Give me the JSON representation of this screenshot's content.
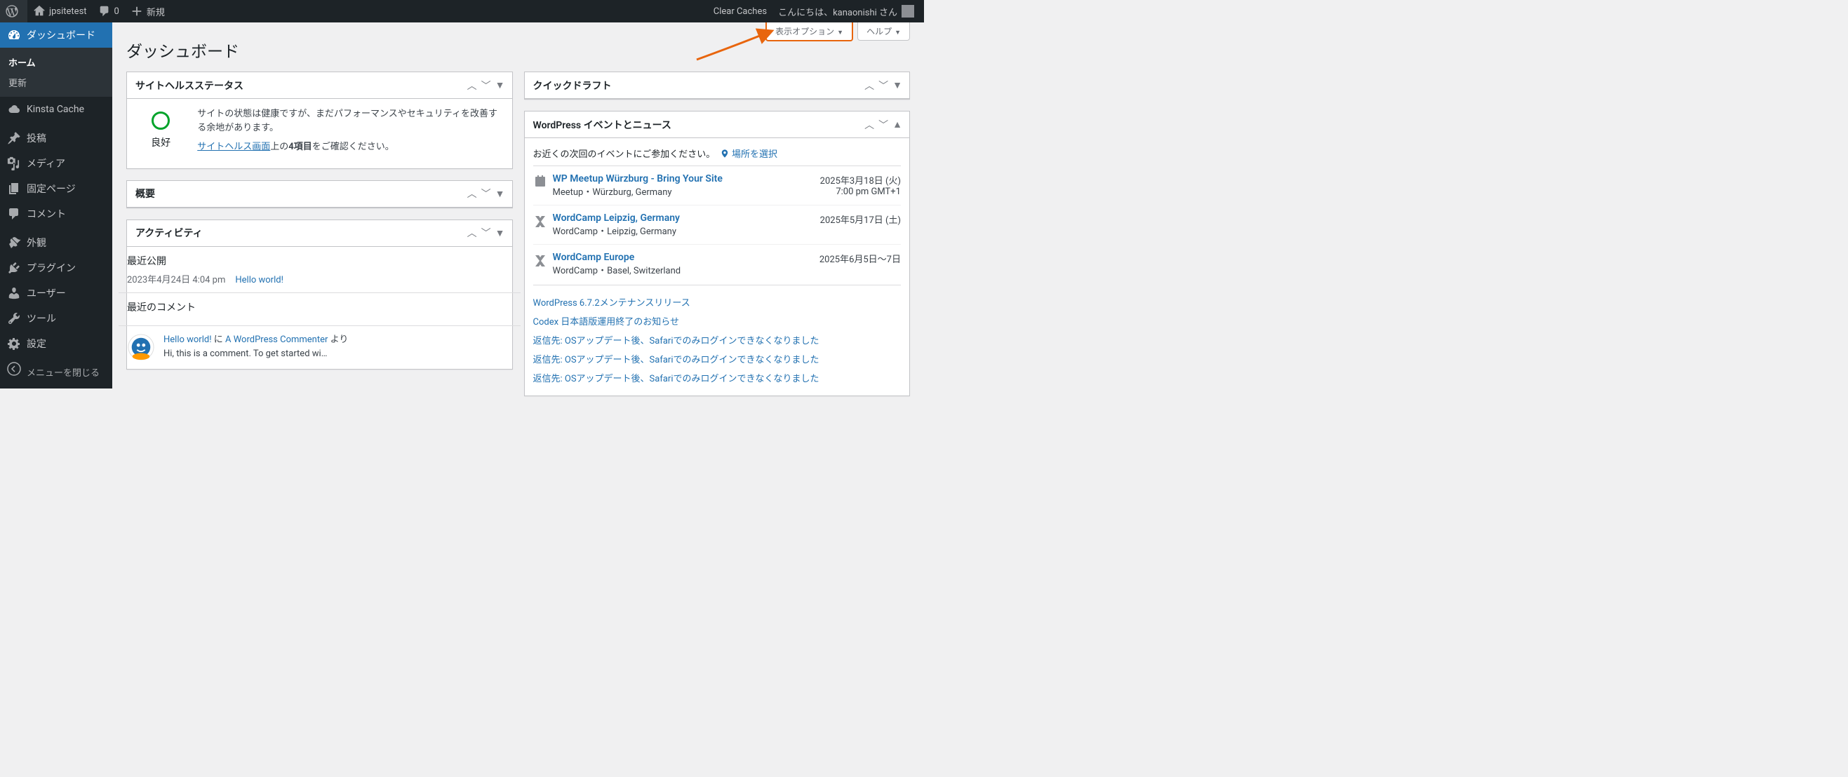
{
  "adminbar": {
    "site_name": "jpsitetest",
    "comments_count": "0",
    "new_label": "新規",
    "clear_caches": "Clear Caches",
    "greeting": "こんにちは、kanaonishi さん"
  },
  "sidebar": {
    "items": [
      {
        "label": "ダッシュボード",
        "icon": "dashboard"
      },
      {
        "label": "Kinsta Cache",
        "icon": "cloud"
      },
      {
        "label": "投稿",
        "icon": "pin"
      },
      {
        "label": "メディア",
        "icon": "media"
      },
      {
        "label": "固定ページ",
        "icon": "page"
      },
      {
        "label": "コメント",
        "icon": "comment"
      },
      {
        "label": "外観",
        "icon": "appearance"
      },
      {
        "label": "プラグイン",
        "icon": "plugin"
      },
      {
        "label": "ユーザー",
        "icon": "user"
      },
      {
        "label": "ツール",
        "icon": "tool"
      },
      {
        "label": "設定",
        "icon": "settings"
      }
    ],
    "submenu": {
      "home": "ホーム",
      "updates": "更新"
    },
    "collapse": "メニューを閉じる"
  },
  "screen_meta": {
    "options": "表示オプション",
    "help": "ヘルプ"
  },
  "page_title": "ダッシュボード",
  "site_health": {
    "title": "サイトヘルスステータス",
    "badge": "良好",
    "line1": "サイトの状態は健康ですが、まだパフォーマンスやセキュリティを改善する余地があります。",
    "link": "サイトヘルス画面",
    "line2a": "上の",
    "line2b": "4項目",
    "line2c": "をご確認ください。"
  },
  "overview": {
    "title": "概要"
  },
  "activity": {
    "title": "アクティビティ",
    "recent_pub": "最近公開",
    "pub_date": "2023年4月24日 4:04 pm",
    "pub_link": "Hello world!",
    "recent_comments": "最近のコメント",
    "comment_post": "Hello world!",
    "comment_sep": " に ",
    "comment_author": "A WordPress Commenter",
    "comment_by": " より",
    "comment_excerpt": "Hi, this is a comment. To get started wi…"
  },
  "quick_draft": {
    "title": "クイックドラフト"
  },
  "events": {
    "title": "WordPress イベントとニュース",
    "nearby": "お近くの次回のイベントにご参加ください。",
    "location_link": "場所を選択",
    "list": [
      {
        "title": "WP Meetup Würzburg - Bring Your Site",
        "meta": "Meetup・Würzburg, Germany",
        "date_l1": "2025年3月18日 (火)",
        "date_l2": "7:00 pm GMT+1",
        "icon": "meetup"
      },
      {
        "title": "WordCamp Leipzig, Germany",
        "meta": "WordCamp・Leipzig, Germany",
        "date_l1": "2025年5月17日 (土)",
        "date_l2": "",
        "icon": "wordcamp"
      },
      {
        "title": "WordCamp Europe",
        "meta": "WordCamp・Basel, Switzerland",
        "date_l1": "2025年6月5日〜7日",
        "date_l2": "",
        "icon": "wordcamp"
      }
    ],
    "news": [
      "WordPress 6.7.2メンテナンスリリース",
      "Codex 日本語版運用終了のお知らせ",
      "返信先: OSアップデート後、Safariでのみログインできなくなりました",
      "返信先: OSアップデート後、Safariでのみログインできなくなりました",
      "返信先: OSアップデート後、Safariでのみログインできなくなりました"
    ]
  }
}
